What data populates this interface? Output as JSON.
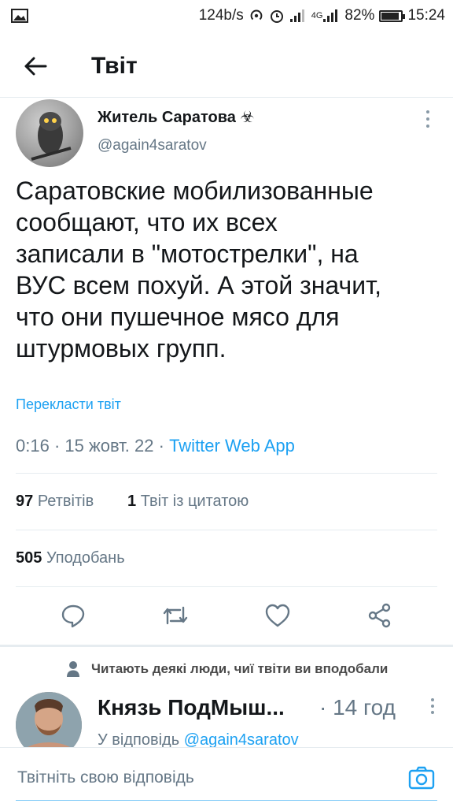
{
  "status_bar": {
    "network_speed": "124b/s",
    "network_type": "4G",
    "battery": "82%",
    "battery_level": 0.82,
    "time": "15:24"
  },
  "header": {
    "title": "Твіт"
  },
  "tweet": {
    "author_name": "Житель Саратова",
    "author_emoji": "☣",
    "handle": "@again4saratov",
    "text": "Саратовские мобилизованные\nсообщают, что их всех\nзаписали в \"мотострелки\", на\nВУС всем похуй. А этой значит,\nчто они пушечное мясо для\nштурмовых групп.",
    "translate": "Перекласти твіт",
    "time": "0:16",
    "date": "15 жовт. 22",
    "sep": "·",
    "app": "Twitter Web App"
  },
  "stats": {
    "retweets_count": "97",
    "retweets_label": "Ретвітів",
    "quotes_count": "1",
    "quotes_label": "Твіт із цитатою",
    "likes_count": "505",
    "likes_label": "Уподобань"
  },
  "actions": [
    "reply-icon",
    "retweet-icon",
    "like-icon",
    "share-icon"
  ],
  "social_context": "Читають деякі люди, чиї твіти ви вподобали",
  "reply": {
    "name": "Князь ПодМыш...",
    "time": "· 14 год",
    "reply_prefix": "У відповідь",
    "reply_handle": "@again4saratov"
  },
  "compose": {
    "placeholder": "Твітніть свою відповідь"
  },
  "colors": {
    "accent": "#1da1f2",
    "muted": "#657786",
    "text": "#14171a",
    "divider": "#e6ecf0"
  }
}
